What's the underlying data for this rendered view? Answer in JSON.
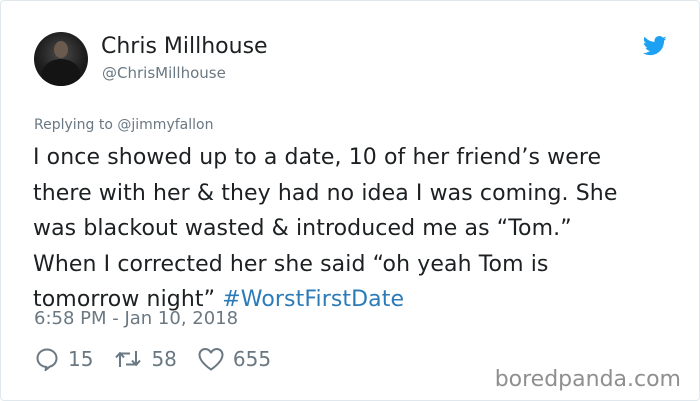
{
  "author": {
    "name": "Chris Millhouse",
    "handle": "@ChrisMillhouse"
  },
  "brand_icon": "twitter-bird-icon",
  "reply": {
    "prefix": "Replying to ",
    "mention": "@jimmyfallon"
  },
  "tweet": {
    "lines": [
      "I once showed up to a date, 10 of her friend’s were",
      "there with her & they had no idea I was coming. She",
      "was blackout wasted & introduced me as “Tom.”",
      "When I corrected her she said “oh yeah Tom is"
    ],
    "last_line_text": "tomorrow night” ",
    "hashtag": "#WorstFirstDate"
  },
  "timestamp": "6:58 PM - Jan 10, 2018",
  "actions": {
    "replies": "15",
    "retweets": "58",
    "likes": "655"
  },
  "watermark": "boredpanda.com",
  "colors": {
    "text": "#1c2022",
    "muted": "#697882",
    "link": "#2b7bb9",
    "twitter_blue": "#1da1f2",
    "border": "#e1e8ed"
  }
}
